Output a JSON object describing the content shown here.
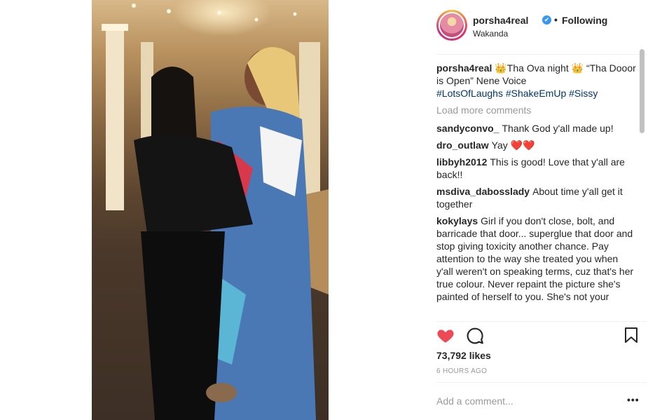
{
  "post": {
    "username": "porsha4real",
    "verified_icon": "✔",
    "separator": "•",
    "follow_status": "Following",
    "location": "Wakanda"
  },
  "caption": {
    "user": "porsha4real",
    "text": "👑Tha Ova night 👑 “Tha Dooor is Open” Nene Voice",
    "hashtags": [
      "#LotsOfLaughs",
      "#ShakeEmUp",
      "#Sissy"
    ]
  },
  "load_more": "Load more comments",
  "comments": [
    {
      "user": "sandyconvo_",
      "text": "Thank God y'all made up!"
    },
    {
      "user": "dro_outlaw",
      "text": "Yay ❤️❤️"
    },
    {
      "user": "libbyh2012",
      "text": "This is good! Love that y'all are back!!"
    },
    {
      "user": "msdiva_dabosslady",
      "text": "About time y'all get it together"
    },
    {
      "user": "kokylays",
      "text": "Girl if you don't close, bolt, and barricade that door... superglue that door and stop giving toxicity another chance. Pay attention to the way she treated you when y'all weren't on speaking terms, cuz that's her true colour. Never repaint the picture she's painted of herself to you. She's not your"
    }
  ],
  "likes": "73,792 likes",
  "time": "6 HOURS AGO",
  "add_comment_placeholder": "Add a comment...",
  "more_icon_text": "•••",
  "icons": {
    "like": "heart-icon",
    "comment": "comment-icon",
    "save": "bookmark-icon",
    "more": "more-options-icon"
  },
  "colors": {
    "heart": "#ed4956",
    "link": "#003569",
    "verified": "#3897f0",
    "muted": "#999999"
  }
}
